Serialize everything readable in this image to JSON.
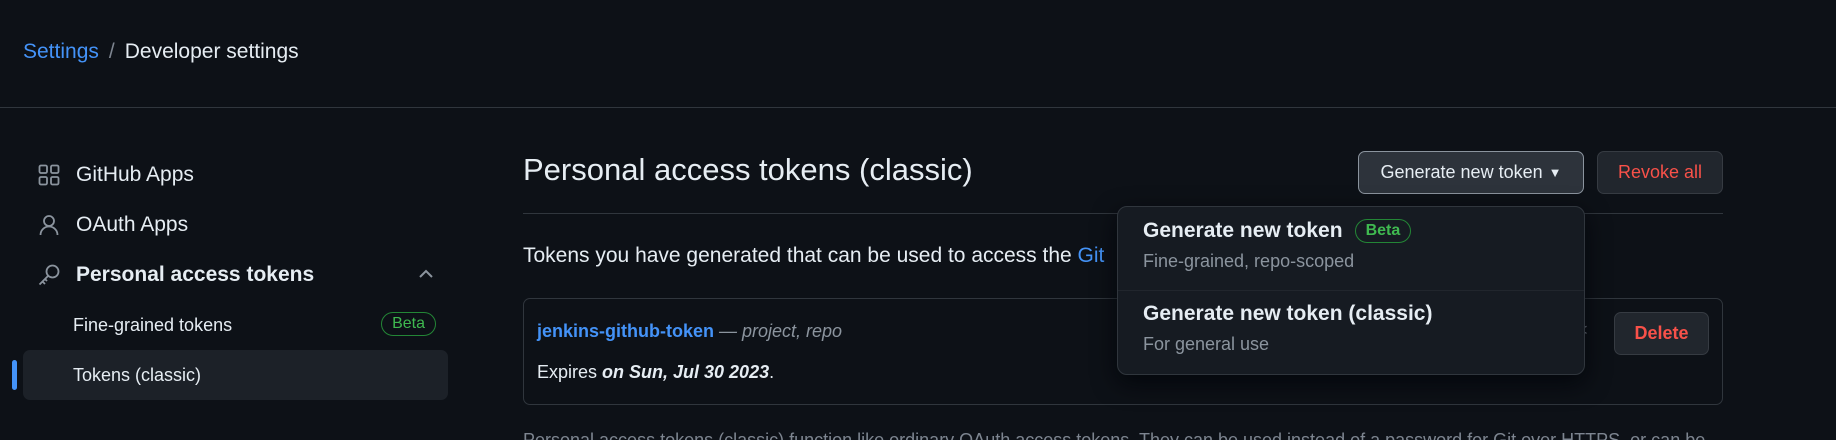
{
  "breadcrumb": {
    "root": "Settings",
    "separator": "/",
    "current": "Developer settings"
  },
  "sidebar": {
    "items": [
      {
        "label": "GitHub Apps",
        "icon": "apps-grid-icon"
      },
      {
        "label": "OAuth Apps",
        "icon": "person-icon"
      },
      {
        "label": "Personal access tokens",
        "icon": "key-icon",
        "expanded": true
      }
    ],
    "sub_items": [
      {
        "label": "Fine-grained tokens",
        "badge": "Beta"
      },
      {
        "label": "Tokens (classic)",
        "active": true
      }
    ]
  },
  "main": {
    "title": "Personal access tokens (classic)",
    "generate_label": "Generate new token",
    "revoke_label": "Revoke all",
    "intro_text": "Tokens you have generated that can be used to access the ",
    "intro_link": "Git",
    "token": {
      "name": "jenkins-github-token",
      "scopes": " — project, repo",
      "expires_prefix": "Expires ",
      "expires_date": "on Sun, Jul 30 2023",
      "expires_suffix": ".",
      "delete_label": "Delete"
    },
    "footer_text": "Personal access tokens (classic) function like ordinary OAuth access tokens. They can be used instead of a password for Git over HTTPS, or can be"
  },
  "dropdown": {
    "items": [
      {
        "title": "Generate new token",
        "badge": "Beta",
        "subtitle": "Fine-grained, repo-scoped"
      },
      {
        "title": "Generate new token (classic)",
        "subtitle": "For general use"
      }
    ]
  },
  "colors": {
    "accent": "#4493f8",
    "danger": "#f85149",
    "success": "#3fb950",
    "background": "#0d1117"
  }
}
